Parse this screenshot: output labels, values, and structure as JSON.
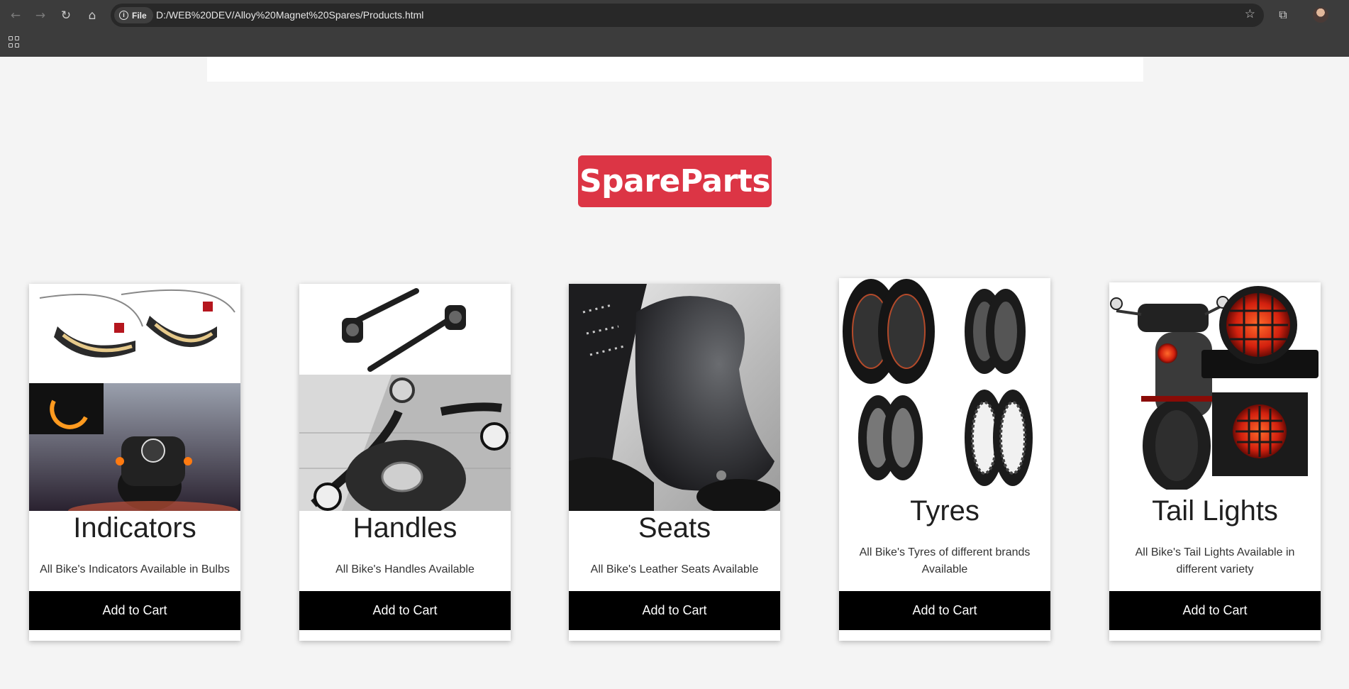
{
  "browser": {
    "url_chip_label": "File",
    "url": "D:/WEB%20DEV/Alloy%20Magnet%20Spares/Products.html"
  },
  "page": {
    "heading": "SpareParts",
    "heading_color": "#dc3545"
  },
  "products": [
    {
      "title": "Indicators",
      "description": "All Bike's Indicators Available in Bulbs",
      "button": "Add to Cart"
    },
    {
      "title": "Handles",
      "description": "All Bike's Handles Available",
      "button": "Add to Cart"
    },
    {
      "title": "Seats",
      "description": "All Bike's Leather Seats Available",
      "button": "Add to Cart"
    },
    {
      "title": "Tyres",
      "description": "All Bike's Tyres of different brands Available",
      "button": "Add to Cart"
    },
    {
      "title": "Tail Lights",
      "description": "All Bike's Tail Lights Available in different variety",
      "button": "Add to Cart"
    }
  ]
}
